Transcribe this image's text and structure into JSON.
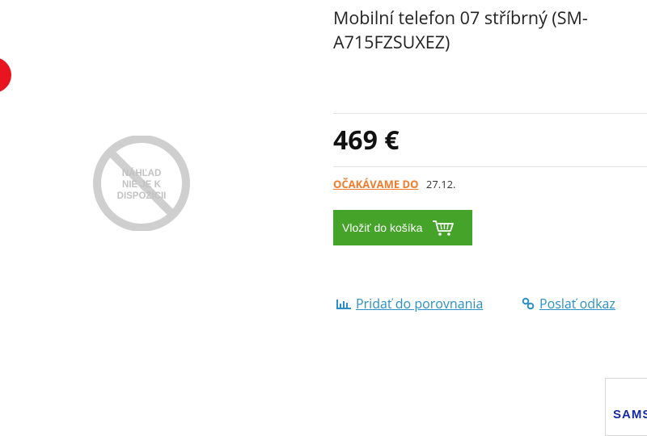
{
  "product": {
    "title": "Mobilní telefon 07 stříbrný (SM-A715FZSUXEZ)",
    "price": "469 €"
  },
  "availability": {
    "status_label": "OČAKÁVAME DO",
    "date": "27.12."
  },
  "actions": {
    "add_to_cart_label": "Vložiť do košíka",
    "compare_label": "Pridať do porovnania",
    "share_label": "Poslať odkaz"
  },
  "image_placeholder": {
    "line1": "NÁHĽAD",
    "line2": "NIE JE K",
    "line3": "DISPOZÍCII"
  },
  "brand": {
    "logo_text": "SAMS"
  },
  "colors": {
    "price_text": "#111111",
    "status_orange": "#f07d2d",
    "cart_green": "#45a32a",
    "link_blue": "#2a8fc6",
    "badge_red": "#e8141f",
    "brand_blue": "#1428a0"
  },
  "icons": {
    "cart": "cart-icon",
    "compare": "bar-chart-icon",
    "share": "link-icon",
    "placeholder": "no-image-icon"
  }
}
